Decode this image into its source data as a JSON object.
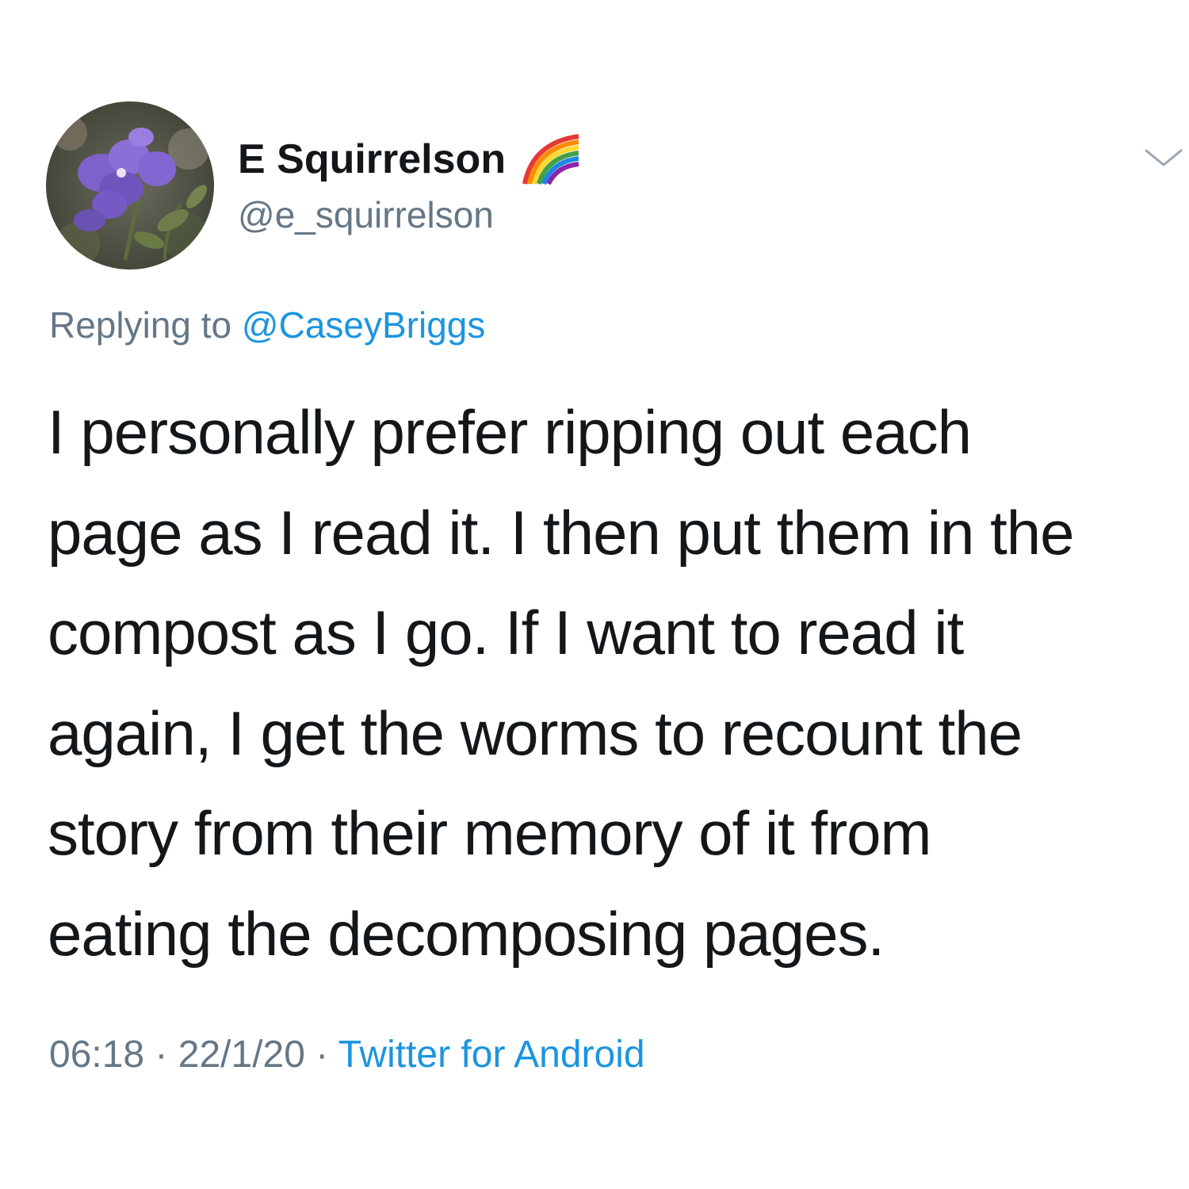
{
  "tweet": {
    "author": {
      "display_name": "E Squirrelson",
      "handle": "@e_squirrelson",
      "avatar_icon": "violet-flower-photo",
      "badge_icon": "rainbow-icon"
    },
    "reply_to": {
      "prefix": "Replying to",
      "mention": "@CaseyBriggs"
    },
    "text_lines": [
      "I personally prefer ripping out each",
      "page as I read it. I then put them in the",
      "compost as I go. If I want to read it",
      "again, I get the worms to recount the",
      "story from their memory of it from",
      "eating the decomposing pages."
    ],
    "meta": {
      "time": "06:18",
      "separator": " · ",
      "date": "22/1/20",
      "source": "Twitter for Android"
    },
    "menu_icon": "chevron-down-icon"
  },
  "colors": {
    "text": "#14171a",
    "secondary": "#657786",
    "link": "#1b95e0",
    "background": "#ffffff"
  }
}
